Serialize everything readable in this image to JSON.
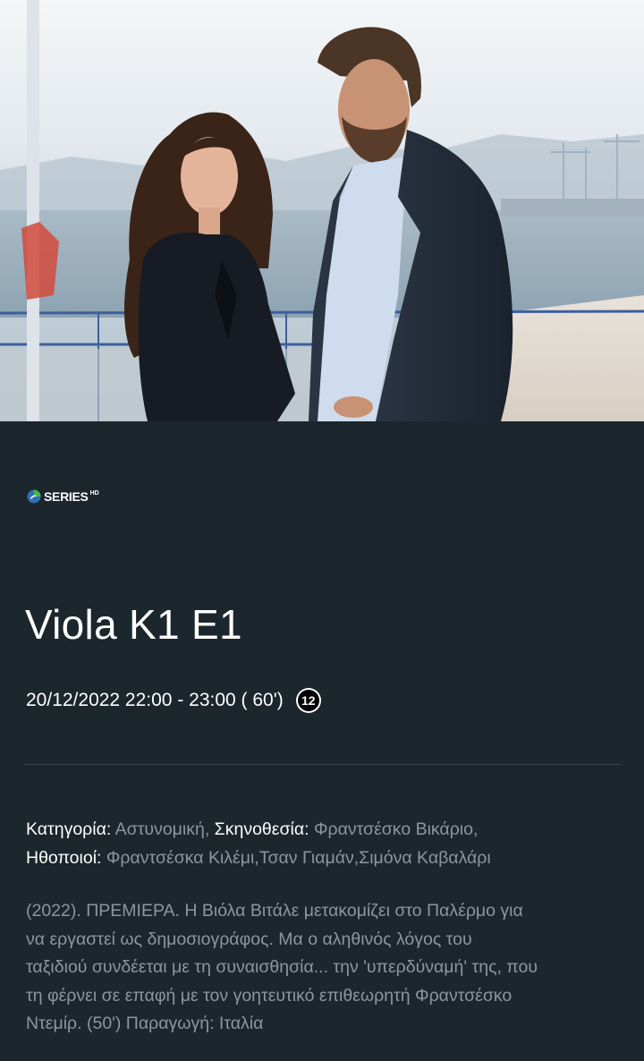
{
  "hero": {
    "image_name": "promo-image-viola"
  },
  "channel": {
    "logo_icon": "series-hd-logo-icon",
    "name": "SERIES",
    "suffix": "HD"
  },
  "program": {
    "title": "Viola K1 E1",
    "schedule": "20/12/2022 22:00 - 23:00 ( 60')",
    "rating": "12"
  },
  "credits": {
    "category_label": "Κατηγορία:",
    "category_value": "Αστυνομική,",
    "director_label": "Σκηνοθεσία:",
    "director_value": "Φραντσέσκο Βικάριο,",
    "cast_label": "Ηθοποιοί:",
    "cast_value": "Φραντσέσκα Κιλέμι,Τσαν Γιαμάν,Σιμόνα Καβαλάρι"
  },
  "description": {
    "lines": [
      "(2022). ΠΡΕΜΙΕΡΑ. Η Βιόλα Βιτάλε μετακομίζει στο Παλέρμο για",
      "να εργαστεί ως δημοσιογράφος. Μα ο αληθινός λόγος του",
      "ταξιδιού συνδέεται με τη συναισθησία... την 'υπερδύναμή' της, που",
      "τη φέρνει σε επαφή με τον γοητευτικό επιθεωρητή Φραντσέσκο",
      "Ντεμίρ. (50') Παραγωγή: Ιταλία"
    ]
  },
  "colors": {
    "background": "#1b262d",
    "muted_text": "#8d969d",
    "divider": "#3a4650"
  }
}
